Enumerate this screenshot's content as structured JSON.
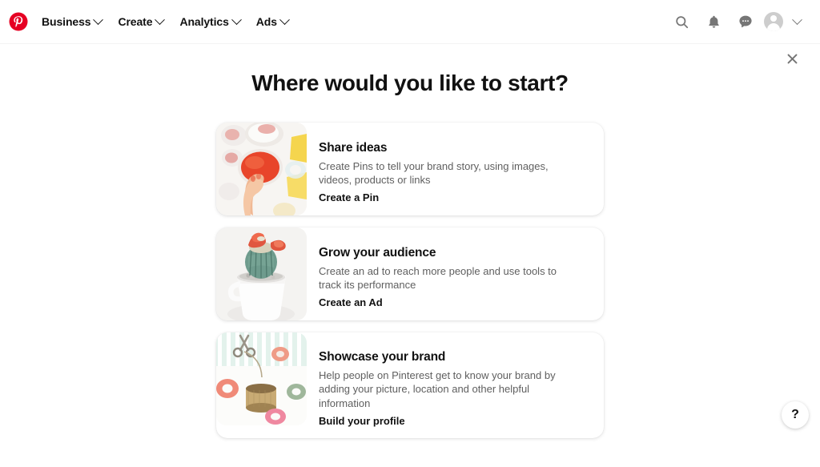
{
  "brand": {
    "logo_icon": "pinterest-logo-icon",
    "logo_color": "#e60023"
  },
  "header": {
    "nav_items": [
      {
        "label": "Business",
        "icon": "chevron-down-icon"
      },
      {
        "label": "Create",
        "icon": "chevron-down-icon"
      },
      {
        "label": "Analytics",
        "icon": "chevron-down-icon"
      },
      {
        "label": "Ads",
        "icon": "chevron-down-icon"
      }
    ],
    "actions": [
      {
        "name": "search-icon"
      },
      {
        "name": "notifications-bell-icon"
      },
      {
        "name": "messages-chat-icon"
      },
      {
        "name": "avatar"
      },
      {
        "name": "chevron-down-icon"
      }
    ]
  },
  "close_button": {
    "icon": "close-icon",
    "label": "✕"
  },
  "main": {
    "title": "Where would you like to start?",
    "cards": [
      {
        "title": "Share ideas",
        "description": "Create Pins to tell your brand story, using images, videos, products or links",
        "cta": "Create a Pin",
        "thumbnail": "baking-hand-red-bowl-photo"
      },
      {
        "title": "Grow your audience",
        "description": "Create an ad to reach more people and use tools to track its performance",
        "cta": "Create an Ad",
        "thumbnail": "flowering-cactus-in-mug-photo"
      },
      {
        "title": "Showcase your brand",
        "description": "Help people on Pinterest get to know your brand by adding your picture, location and other helpful information",
        "cta": "Build your profile",
        "thumbnail": "craft-supplies-twine-scissors-photo"
      }
    ]
  },
  "help_button": {
    "label": "?",
    "icon": "question-mark-icon"
  },
  "colors": {
    "accent": "#e60023",
    "text_primary": "#111111",
    "text_secondary": "#5f5f5f",
    "background": "#ffffff"
  }
}
